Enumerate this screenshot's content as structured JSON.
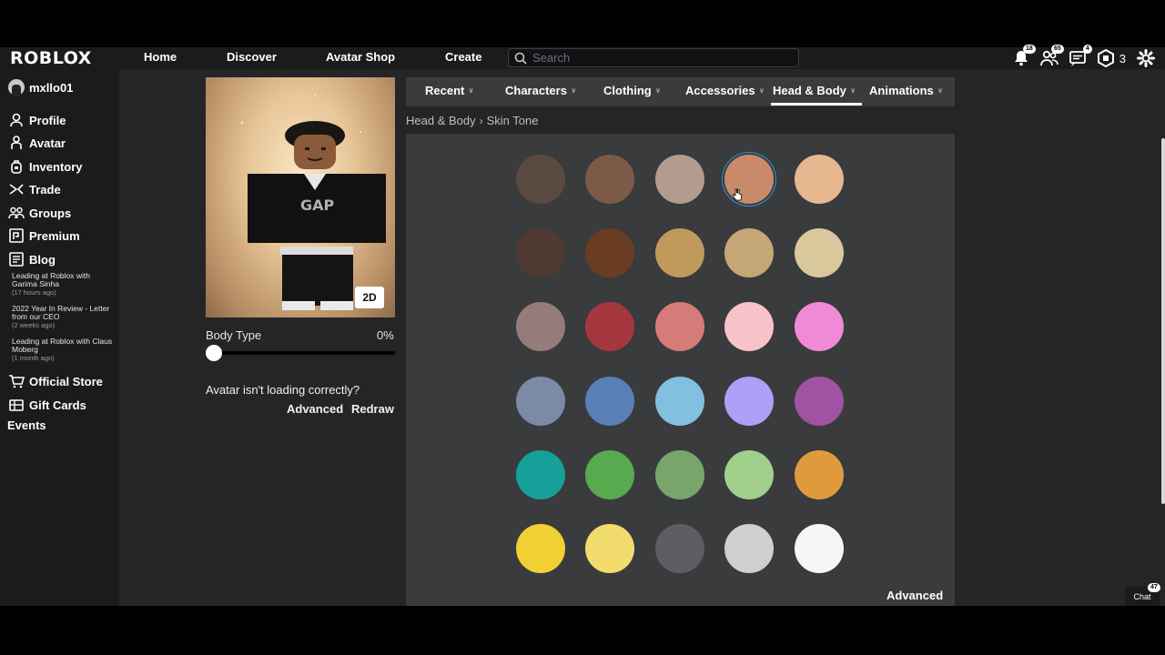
{
  "nav": {
    "logo": "ROBLOX",
    "links": [
      "Home",
      "Discover",
      "Avatar Shop",
      "Create"
    ],
    "search_placeholder": "Search",
    "notification_count": "18",
    "friends_count": "65",
    "messages_count": "4",
    "robux": "3"
  },
  "sidebar": {
    "username": "mxllo01",
    "items": [
      "Profile",
      "Avatar",
      "Inventory",
      "Trade",
      "Groups",
      "Premium",
      "Blog"
    ],
    "blog_posts": [
      {
        "title": "Leading at Roblox with Garima Sinha",
        "time": "(17 hours ago)"
      },
      {
        "title": "2022 Year In Review - Letter from our CEO",
        "time": "(2 weeks ago)"
      },
      {
        "title": "Leading at Roblox with Claus Moberg",
        "time": "(1 month ago)"
      }
    ],
    "bottom_items": [
      "Official Store",
      "Gift Cards"
    ],
    "events": "Events"
  },
  "avatar": {
    "view_toggle": "2D",
    "body_type_label": "Body Type",
    "body_type_value": "0%",
    "body_type_level": 0,
    "loading_text": "Avatar isn't loading correctly?",
    "advanced_label": "Advanced",
    "redraw_label": "Redraw"
  },
  "tabs": [
    "Recent",
    "Characters",
    "Clothing",
    "Accessories",
    "Head & Body",
    "Animations"
  ],
  "active_tab": "Head & Body",
  "breadcrumb": {
    "parent": "Head & Body",
    "current": "Skin Tone"
  },
  "skin_tones": [
    [
      "#5a4a40",
      "#7c5a48",
      "#b39b8e",
      "#c98a6b",
      "#e7b78f"
    ],
    [
      "#4f3a31",
      "#6b3c24",
      "#bf9a5c",
      "#c5a675",
      "#d8c89c"
    ],
    [
      "#957b7a",
      "#a5373f",
      "#d67c78",
      "#f7c3c8",
      "#f08ad6"
    ],
    [
      "#7b8aa5",
      "#5a7fb6",
      "#83bfde",
      "#ae9ff7",
      "#a053a2"
    ],
    [
      "#16a09a",
      "#59a94e",
      "#77a56a",
      "#a1cf8c",
      "#e09a3c"
    ],
    [
      "#f0d033",
      "#f1dc6d",
      "#5f5d61",
      "#cfcfcf",
      "#f5f6f7"
    ]
  ],
  "selected_tone": {
    "row": 0,
    "col": 3
  },
  "panel_advanced_label": "Advanced",
  "chat": {
    "label": "Chat",
    "count": "47"
  }
}
